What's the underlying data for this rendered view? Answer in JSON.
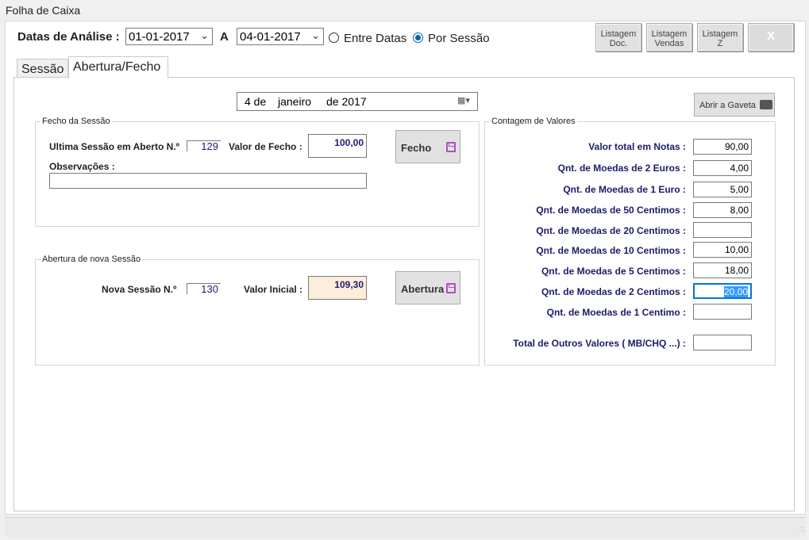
{
  "window": {
    "title": "Folha de Caixa"
  },
  "filters": {
    "label": "Datas de Análise :",
    "date_from": "01-01-2017",
    "sep": "A",
    "date_to": "04-01-2017",
    "radio_between": "Entre Datas",
    "radio_session": "Por Sessão",
    "selected": "Por Sessão"
  },
  "toolbar": {
    "btn_doc": [
      "Listagem",
      "Doc."
    ],
    "btn_vendas": [
      "Listagem",
      "Vendas"
    ],
    "btn_z": [
      "Listagem",
      "Z"
    ],
    "btn_close": "X"
  },
  "tabs": [
    {
      "label": "Sessão",
      "active": false
    },
    {
      "label": "Abertura/Fecho",
      "active": true
    }
  ],
  "date_picker": {
    "day": "4 de",
    "month": "janeiro",
    "year": "de 2017"
  },
  "drawer_button": "Abrir a Gaveta",
  "fecho": {
    "group_title": "Fecho da Sessão",
    "last_session_label": "Ultima Sessão em Aberto N.º",
    "last_session_value": "129",
    "close_value_label": "Valor de Fecho :",
    "close_value": "100,00",
    "notes_label": "Observações :",
    "notes_value": "",
    "button": "Fecho"
  },
  "abertura": {
    "group_title": "Abertura de nova Sessão",
    "new_session_label": "Nova Sessão N.º",
    "new_session_value": "130",
    "initial_value_label": "Valor Inicial :",
    "initial_value": "109,30",
    "button": "Abertura"
  },
  "contagem": {
    "group_title": "Contagem de Valores",
    "rows": [
      {
        "label": "Valor total em Notas :",
        "value": "90,00"
      },
      {
        "label": "Qnt. de Moedas de 2 Euros :",
        "value": "4,00"
      },
      {
        "label": "Qnt. de Moedas de 1 Euro :",
        "value": "5,00"
      },
      {
        "label": "Qnt. de Moedas de 50 Centimos :",
        "value": "8,00"
      },
      {
        "label": "Qnt. de Moedas de 20 Centimos :",
        "value": ""
      },
      {
        "label": "Qnt. de Moedas de 10 Centimos :",
        "value": "10,00"
      },
      {
        "label": "Qnt. de Moedas de 5 Centimos :",
        "value": "18,00"
      },
      {
        "label": "Qnt. de Moedas de 2 Centimos :",
        "value": "20,00"
      },
      {
        "label": "Qnt. de Moedas de 1 Centimo :",
        "value": ""
      },
      {
        "label": "Total de Outros Valores ( MB/CHQ ...) :",
        "value": ""
      }
    ]
  }
}
